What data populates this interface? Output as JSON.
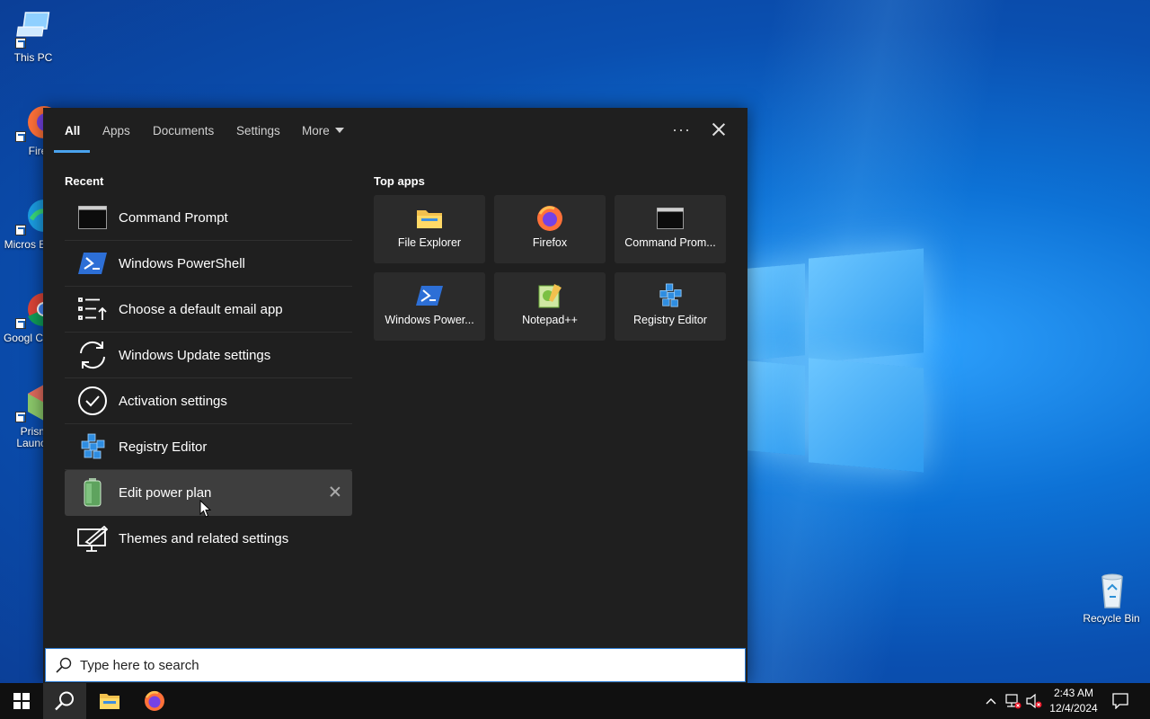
{
  "desktop": {
    "icons": [
      {
        "label": "This PC"
      },
      {
        "label": "Firefo"
      },
      {
        "label": "Micros Edge"
      },
      {
        "label": "Googl Chron"
      },
      {
        "label": "Prism Launch"
      },
      {
        "label": "Recycle Bin"
      }
    ]
  },
  "search_panel": {
    "tabs": [
      {
        "label": "All"
      },
      {
        "label": "Apps"
      },
      {
        "label": "Documents"
      },
      {
        "label": "Settings"
      },
      {
        "label": "More"
      }
    ],
    "recent_heading": "Recent",
    "recent": [
      {
        "label": "Command Prompt",
        "icon": "command-prompt-icon"
      },
      {
        "label": "Windows PowerShell",
        "icon": "powershell-icon"
      },
      {
        "label": "Choose a default email app",
        "icon": "list-settings-icon"
      },
      {
        "label": "Windows Update settings",
        "icon": "refresh-icon"
      },
      {
        "label": "Activation settings",
        "icon": "checkmark-circle-icon"
      },
      {
        "label": "Registry Editor",
        "icon": "registry-editor-icon"
      },
      {
        "label": "Edit power plan",
        "icon": "battery-icon"
      },
      {
        "label": "Themes and related settings",
        "icon": "pen-monitor-icon"
      }
    ],
    "top_apps_heading": "Top apps",
    "top_apps": [
      {
        "label": "File Explorer",
        "icon": "folder-icon"
      },
      {
        "label": "Firefox",
        "icon": "firefox-icon"
      },
      {
        "label": "Command Prom...",
        "icon": "command-prompt-icon"
      },
      {
        "label": "Windows Power...",
        "icon": "powershell-icon"
      },
      {
        "label": "Notepad++",
        "icon": "notepad-plus-plus-icon"
      },
      {
        "label": "Registry Editor",
        "icon": "registry-editor-icon"
      }
    ],
    "search_placeholder": "Type here to search"
  },
  "taskbar": {
    "clock_time": "2:43 AM",
    "clock_date": "12/4/2024"
  },
  "colors": {
    "accent": "#4aa3ee",
    "panel_bg": "#1f1f1f",
    "tile_bg": "#2b2b2b",
    "hover_bg": "#3e3e3e",
    "taskbar_bg": "#101010"
  }
}
